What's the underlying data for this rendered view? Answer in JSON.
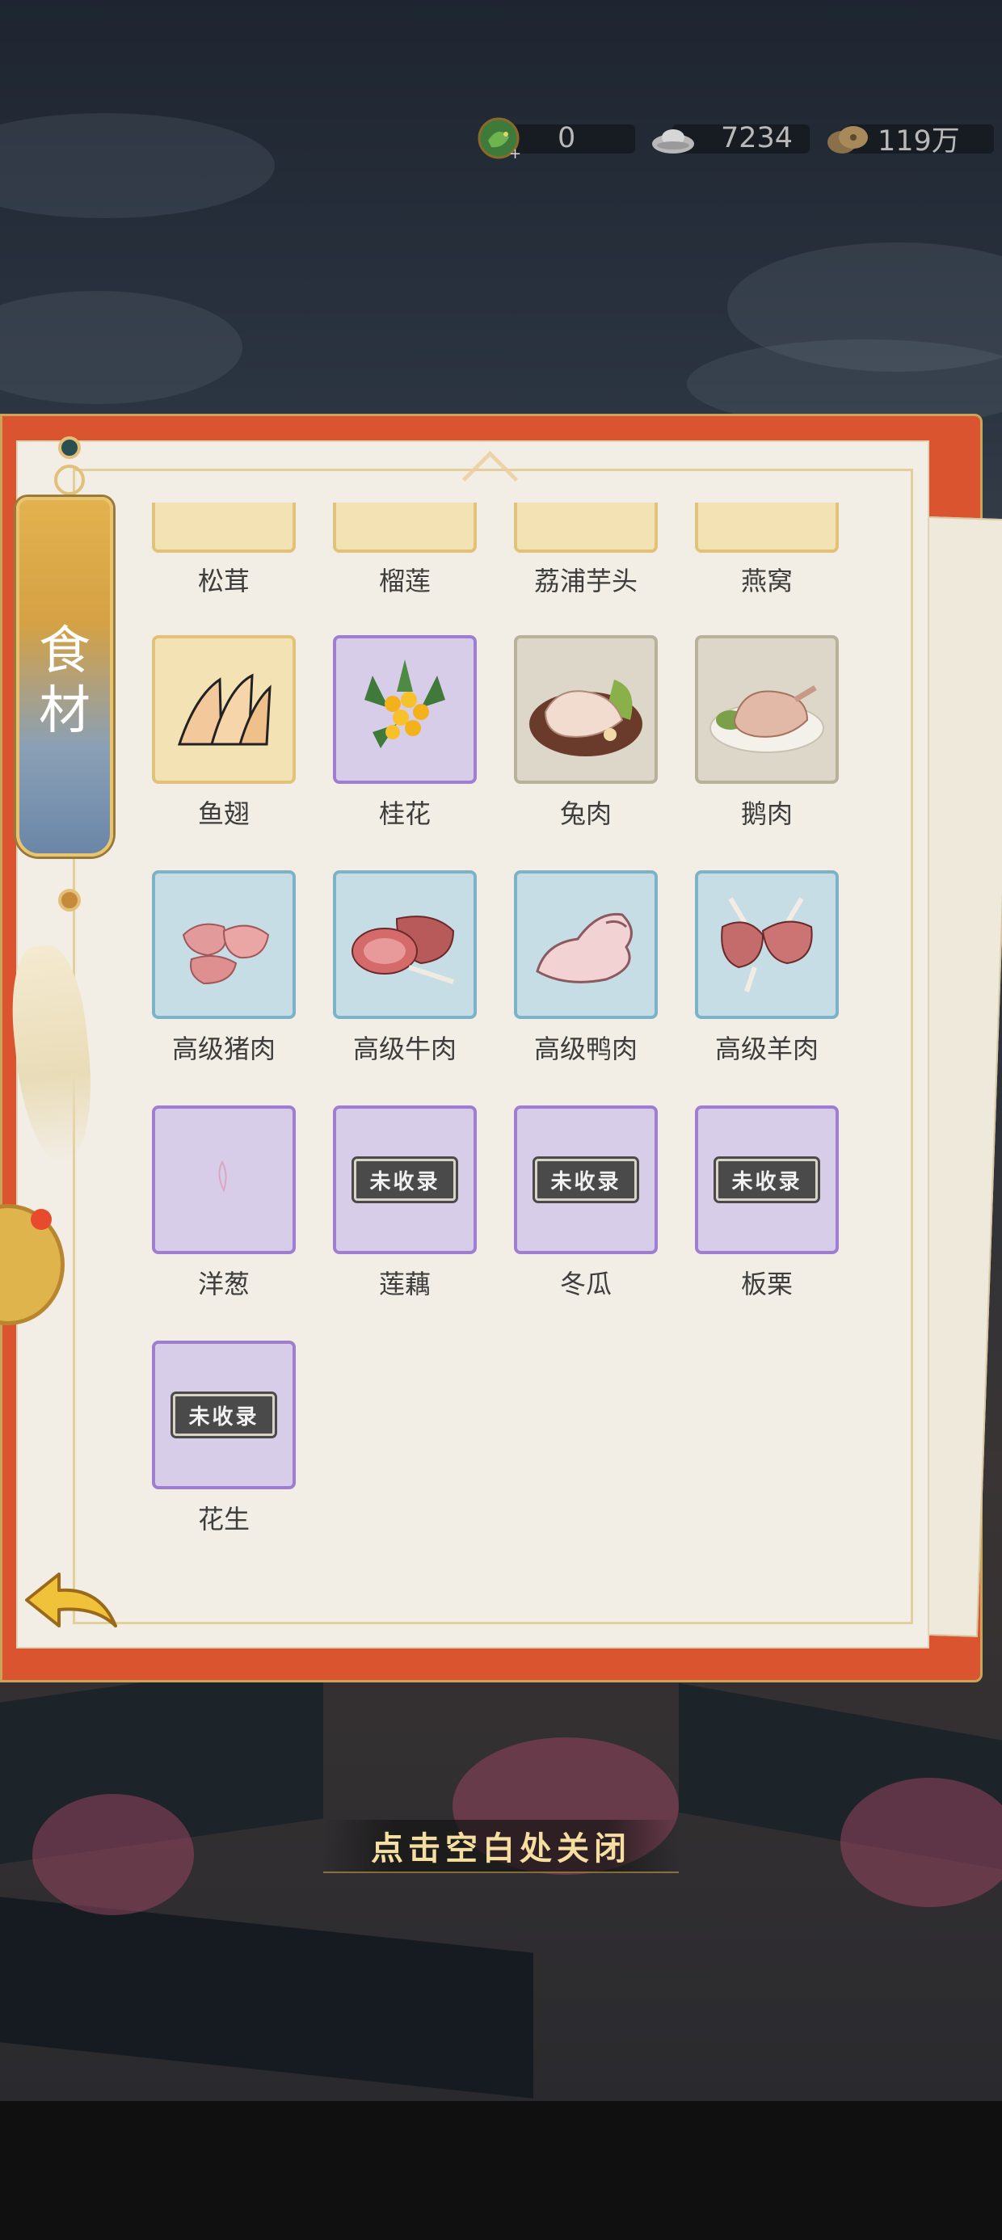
{
  "currencies": [
    {
      "icon": "jade-dragon-icon",
      "value": "0"
    },
    {
      "icon": "silver-ingot-icon",
      "value": "7234"
    },
    {
      "icon": "copper-coins-icon",
      "value": "119万"
    }
  ],
  "tab": {
    "label": "食材"
  },
  "ingredients": {
    "top_row": [
      {
        "name": "松茸",
        "rarity": "gold"
      },
      {
        "name": "榴莲",
        "rarity": "gold"
      },
      {
        "name": "荔浦芋头",
        "rarity": "gold"
      },
      {
        "name": "燕窝",
        "rarity": "gold"
      }
    ],
    "rows": [
      [
        {
          "name": "鱼翅",
          "rarity": "gold",
          "icon": "shark-fin-icon"
        },
        {
          "name": "桂花",
          "rarity": "purple",
          "icon": "osmanthus-icon"
        },
        {
          "name": "兔肉",
          "rarity": "grey",
          "icon": "rabbit-meat-icon"
        },
        {
          "name": "鹅肉",
          "rarity": "grey",
          "icon": "goose-meat-icon"
        }
      ],
      [
        {
          "name": "高级猪肉",
          "rarity": "blue",
          "icon": "pork-icon"
        },
        {
          "name": "高级牛肉",
          "rarity": "blue",
          "icon": "beef-icon"
        },
        {
          "name": "高级鸭肉",
          "rarity": "blue",
          "icon": "duck-icon"
        },
        {
          "name": "高级羊肉",
          "rarity": "blue",
          "icon": "lamb-chop-icon"
        }
      ],
      [
        {
          "name": "洋葱",
          "rarity": "purple",
          "icon": "empty-slot-icon"
        },
        {
          "name": "莲藕",
          "rarity": "purple",
          "badge": "未收录"
        },
        {
          "name": "冬瓜",
          "rarity": "purple",
          "badge": "未收录"
        },
        {
          "name": "板栗",
          "rarity": "purple",
          "badge": "未收录"
        }
      ],
      [
        {
          "name": "花生",
          "rarity": "purple",
          "badge": "未收录"
        }
      ]
    ]
  },
  "hint": "点击空白处关闭",
  "colors": {
    "book_red": "#d9542f",
    "gold_tile": "#f3e3b4",
    "purple_tile": "#d8cde8",
    "blue_tile": "#c6dde5",
    "grey_tile": "#dcd7c8"
  }
}
